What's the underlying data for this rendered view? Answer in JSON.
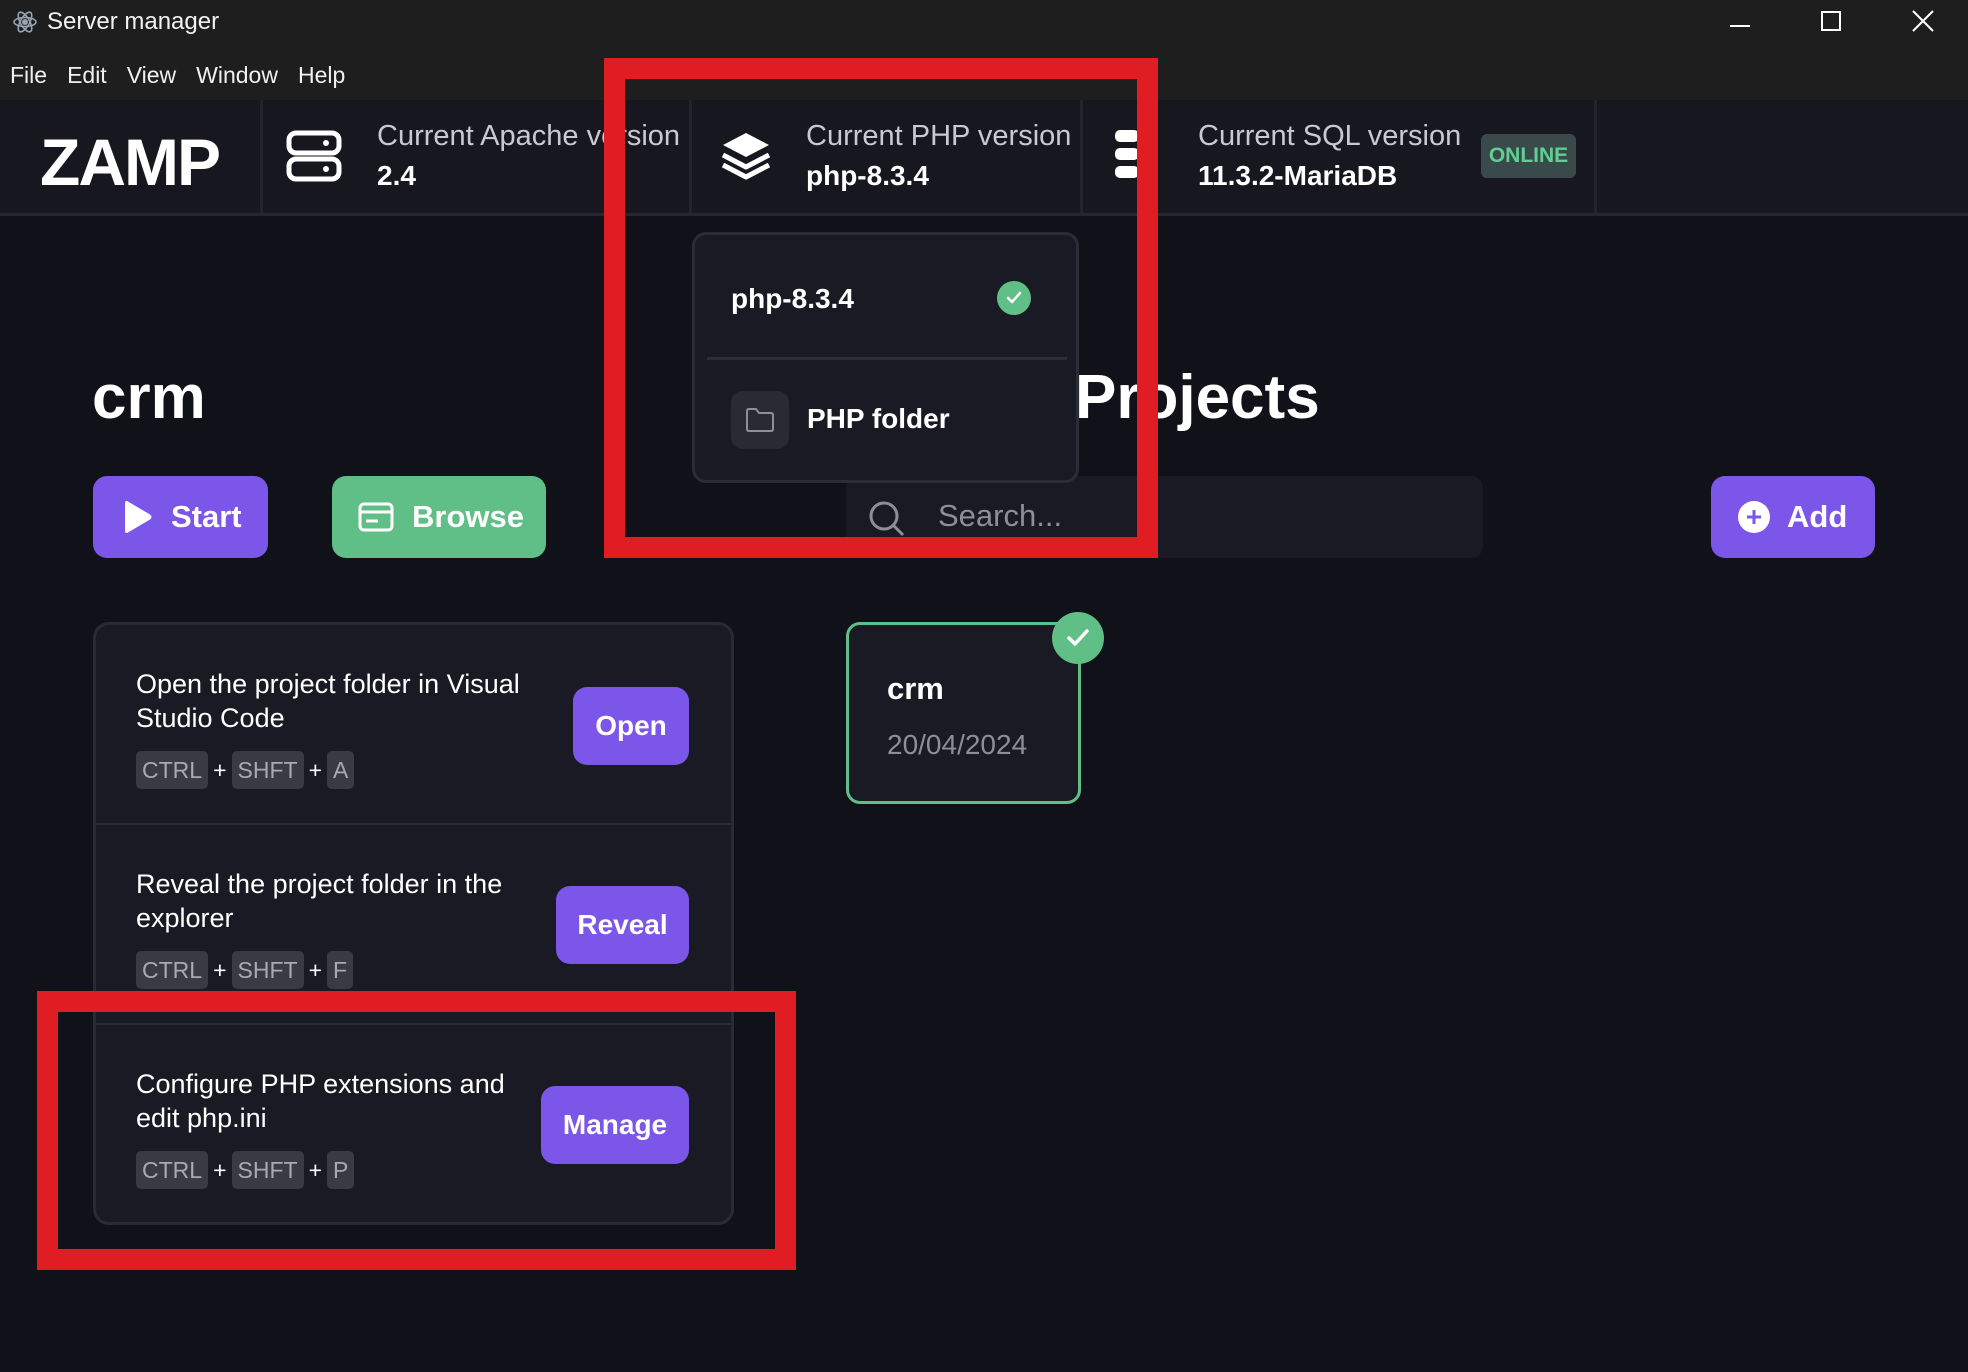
{
  "window": {
    "title": "Server manager"
  },
  "menu": [
    "File",
    "Edit",
    "View",
    "Window",
    "Help"
  ],
  "header": {
    "logo": "ZAMP",
    "apache": {
      "label": "Current Apache version",
      "value": "2.4"
    },
    "php": {
      "label": "Current PHP version",
      "value": "php-8.3.4"
    },
    "sql": {
      "label": "Current SQL version",
      "value": "11.3.2-MariaDB",
      "status": "ONLINE"
    }
  },
  "dropdown": {
    "selected": "php-8.3.4",
    "folder": "PHP folder"
  },
  "project": {
    "name": "crm",
    "start": "Start",
    "browse": "Browse"
  },
  "actions": [
    {
      "text": "Open the project folder in Visual Studio Code",
      "keys": [
        "CTRL",
        "SHFT",
        "A"
      ],
      "button": "Open"
    },
    {
      "text": "Reveal the project folder in the explorer",
      "keys": [
        "CTRL",
        "SHFT",
        "F"
      ],
      "button": "Reveal"
    },
    {
      "text": "Configure PHP extensions and edit php.ini",
      "keys": [
        "CTRL",
        "SHFT",
        "P"
      ],
      "button": "Manage"
    }
  ],
  "projects": {
    "title": "Projects",
    "search_placeholder": "Search...",
    "add": "Add",
    "cards": [
      {
        "name": "crm",
        "date": "20/04/2024"
      }
    ]
  },
  "colors": {
    "accent": "#7b56e8",
    "success": "#5fbf86",
    "highlight": "#e11d24",
    "background": "#11111a"
  }
}
